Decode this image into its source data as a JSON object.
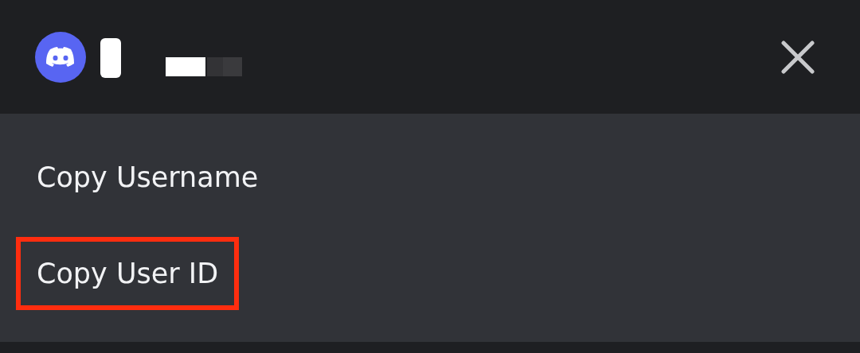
{
  "menu_items": [
    {
      "label": "Copy Username",
      "highlighted": false
    },
    {
      "label": "Copy User ID",
      "highlighted": true
    }
  ]
}
